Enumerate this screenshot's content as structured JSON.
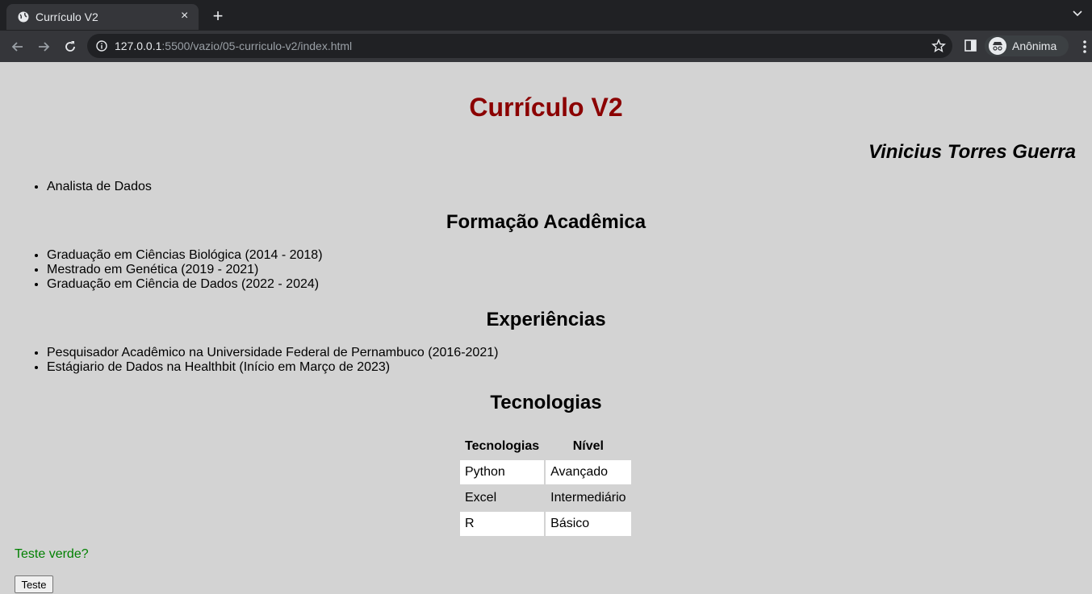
{
  "browser": {
    "tab_title": "Currículo V2",
    "tab_close": "×",
    "new_tab": "+",
    "url_host": "127.0.0.1",
    "url_rest": ":5500/vazio/05-curriculo-v2/index.html",
    "profile_name": "Anônima"
  },
  "page": {
    "title": "Currículo V2",
    "name": "Vinicius Torres Guerra",
    "role_items": [
      "Analista de Dados"
    ],
    "education_heading": "Formação Acadêmica",
    "education_items": [
      "Graduação em Ciências Biológica (2014 - 2018)",
      "Mestrado em Genética (2019 - 2021)",
      "Graduação em Ciência de Dados (2022 - 2024)"
    ],
    "experience_heading": "Experiências",
    "experience_items": [
      "Pesquisador Acadêmico na Universidade Federal de Pernambuco (2016-2021)",
      "Estágiario de Dados na Healthbit (Início em Março de 2023)"
    ],
    "tech_heading": "Tecnologias",
    "tech_table": {
      "headers": [
        "Tecnologias",
        "Nível"
      ],
      "rows": [
        [
          "Python",
          "Avançado"
        ],
        [
          "Excel",
          "Intermediário"
        ],
        [
          "R",
          "Básico"
        ]
      ]
    },
    "green_text": "Teste verde?",
    "button_label": "Teste"
  },
  "colors": {
    "title": "#8b0000",
    "background": "#d3d3d3",
    "green_text": "#008000"
  }
}
